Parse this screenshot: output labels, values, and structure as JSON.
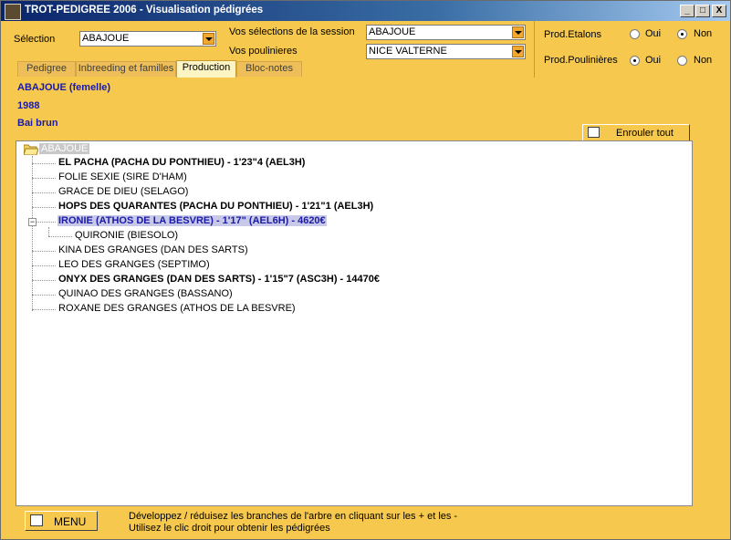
{
  "window": {
    "title": "TROT-PEDIGREE 2006  -  Visualisation pédigrées",
    "minimize": "_",
    "maximize": "□",
    "close": "X"
  },
  "selection": {
    "label": "Sélection",
    "value": "ABAJOUE"
  },
  "session": {
    "label": "Vos sélections de la session",
    "value": "ABAJOUE"
  },
  "poulinieres": {
    "label": "Vos poulinieres",
    "value": "NICE VALTERNE"
  },
  "prod_etalons": {
    "label": "Prod.Etalons",
    "oui": "Oui",
    "non": "Non",
    "selected": "Non"
  },
  "prod_poulinieres": {
    "label": "Prod.Poulinières",
    "oui": "Oui",
    "non": "Non",
    "selected": "Oui"
  },
  "tabs": [
    {
      "label": "Pedigree"
    },
    {
      "label": "Inbreeding et familles"
    },
    {
      "label": "Production"
    },
    {
      "label": "Bloc-notes"
    }
  ],
  "active_tab": "Production",
  "horse": {
    "name": "ABAJOUE  (femelle)",
    "year": "1988",
    "coat": "Bai brun"
  },
  "enrouler_button": "Enrouler tout",
  "tree": {
    "root": "ABAJOUE",
    "children": [
      {
        "label": "EL PACHA (PACHA DU PONTHIEU)  -  1'23\"4 (AEL3H)"
      },
      {
        "label": "FOLIE SEXIE (SIRE D'HAM)"
      },
      {
        "label": "GRACE DE DIEU (SELAGO)"
      },
      {
        "label": "HOPS DES QUARANTES (PACHA DU PONTHIEU)  -  1'21\"1 (AEL3H)"
      },
      {
        "label": "IRONIE (ATHOS DE LA BESVRE)  -  1'17\" (AEL6H)  -  4620€"
      },
      {
        "label": "QUIRONIE (BIESOLO)"
      },
      {
        "label": "KINA DES GRANGES (DAN DES SARTS)"
      },
      {
        "label": "LEO DES GRANGES (SEPTIMO)"
      },
      {
        "label": "ONYX DES GRANGES (DAN DES SARTS)  -  1'15\"7 (ASC3H)  -  14470€"
      },
      {
        "label": "QUINAO DES GRANGES (BASSANO)"
      },
      {
        "label": "ROXANE DES GRANGES (ATHOS DE LA BESVRE)"
      }
    ]
  },
  "menu_button": "MENU",
  "footer": {
    "line1": "Développez / réduisez les branches de l'arbre en cliquant sur les + et les -",
    "line2": "Utilisez le clic droit pour obtenir les pédigrées"
  }
}
